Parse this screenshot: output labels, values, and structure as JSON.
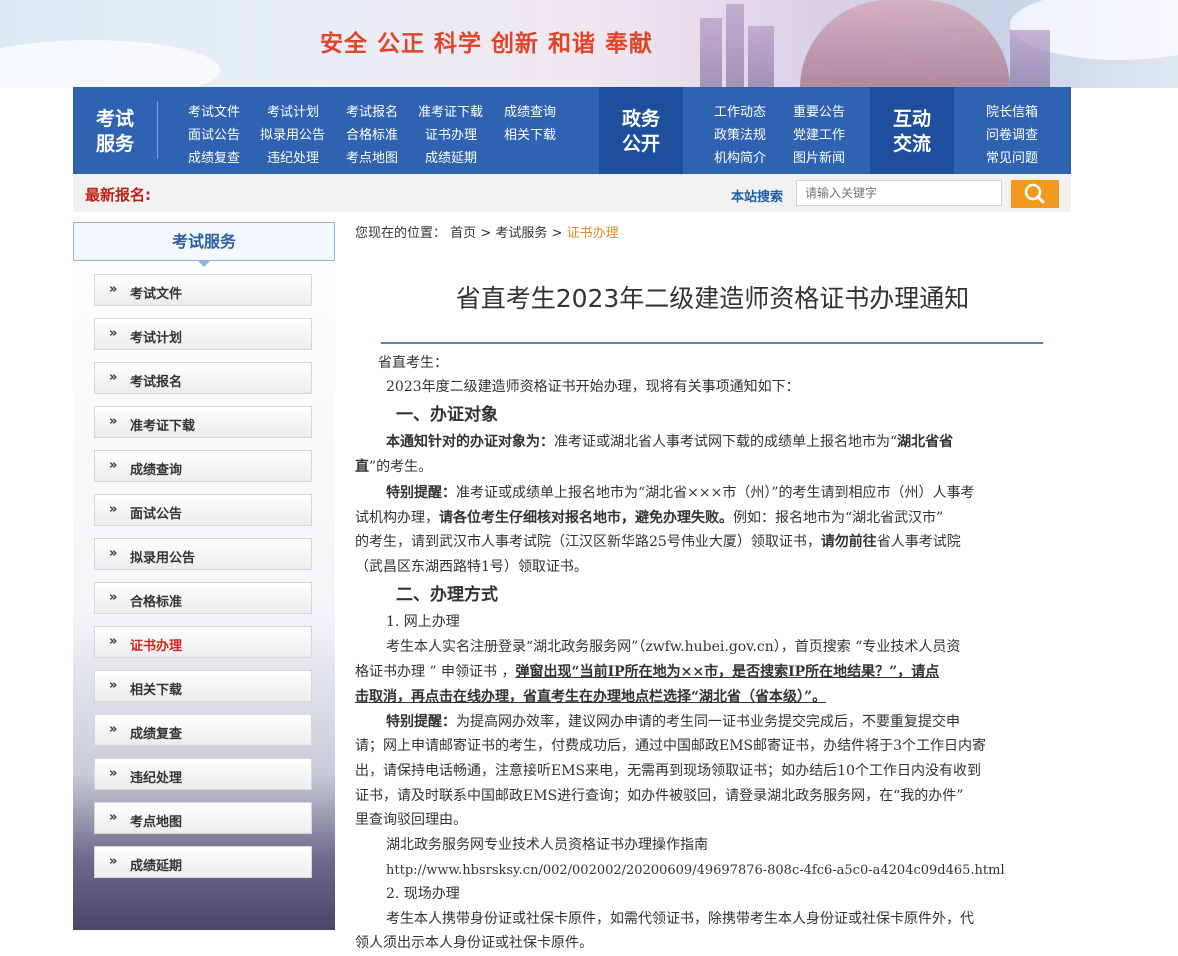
{
  "banner": {
    "slogan": "安全 公正 科学 创新 和谐 奉献"
  },
  "nav": {
    "exam_service_title": [
      "考试",
      "服务"
    ],
    "exam_links": [
      [
        "考试文件",
        "考试计划",
        "考试报名",
        "准考证下载",
        "成绩查询"
      ],
      [
        "面试公告",
        "拟录用公告",
        "合格标准",
        "证书办理",
        "相关下载"
      ],
      [
        "成绩复查",
        "违纪处理",
        "考点地图",
        "成绩延期"
      ]
    ],
    "gov_title": [
      "政务",
      "公开"
    ],
    "gov_links": [
      [
        "工作动态",
        "重要公告"
      ],
      [
        "政策法规",
        "党建工作"
      ],
      [
        "机构简介",
        "图片新闻"
      ]
    ],
    "interact_title": [
      "互动",
      "交流"
    ],
    "interact_links": [
      "院长信箱",
      "问卷调查",
      "常见问题"
    ]
  },
  "search": {
    "latest_label": "最新报名:",
    "site_search": "本站搜索",
    "placeholder": "请输入关键字"
  },
  "sidebar": {
    "title": "考试服务",
    "arrow": "»",
    "items": [
      "考试文件",
      "考试计划",
      "考试报名",
      "准考证下载",
      "成绩查询",
      "面试公告",
      "拟录用公告",
      "合格标准",
      "证书办理",
      "相关下载",
      "成绩复查",
      "违纪处理",
      "考点地图",
      "成绩延期"
    ],
    "active_index": 8
  },
  "breadcrumb": {
    "prefix": "您现在的位置：",
    "home": "首页",
    "sep": ">",
    "section": "考试服务",
    "current": "证书办理"
  },
  "article": {
    "title": "省直考生2023年二级建造师资格证书办理通知",
    "greeting": "省直考生：",
    "intro": "2023年度二级建造师资格证书开始办理，现将有关事项通知如下：",
    "h1": "一、办证对象",
    "p1_bold": "本通知针对的办证对象为：",
    "p1_text": "准考证或湖北省人事考试网下载的成绩单上报名地市为“",
    "p1_bold2a": "湖北省省",
    "p1_bold2b": "直",
    "p1_tail": "”的考生。",
    "p2_label": "特别提醒：",
    "p2_a": "准考证或成绩单上报名地市为“湖北省×××市（州）”的考生请到相应市（州）人事考",
    "p2_b1": "试机构办理，",
    "p2_b2": "请各位考生仔细核对报名地市，避免办理失败。",
    "p2_b3": "例如：报名地市为“湖北省武汉市”",
    "p2_c1": "的考生，请到武汉市人事考试院（江汉区新华路25号伟业大厦）领取证书，",
    "p2_c2": "请勿前往",
    "p2_c3": "省人事考试院",
    "p2_d": "（武昌区东湖西路特1号）领取证书。",
    "h2": "二、办理方式",
    "s1": "1. 网上办理",
    "s1_a": "考生本人实名注册登录“湖北政务服务网”（zwfw.hubei.gov.cn），首页搜索 “专业技术人员资",
    "s1_b1": "格证书办理 ” 申领证书 ，",
    "s1_b2": "弹窗出现“当前IP所在地为××市，是否搜索IP所在地结果？”，请点",
    "s1_c": "击取消，再点击在线办理，省直考生在办理地点栏选择“湖北省（省本级）”。",
    "p3_label": "特别提醒：",
    "p3_a": "为提高网办效率，建议网办申请的考生同一证书业务提交完成后，不要重复提交申",
    "p3_b": "请；网上申请邮寄证书的考生，付费成功后，通过中国邮政EMS邮寄证书，办结件将于3个工作日内寄",
    "p3_c": "出，请保持电话畅通，注意接听EMS来电，无需再到现场领取证书；如办结后10个工作日内没有收到",
    "p3_d": "证书，请及时联系中国邮政EMS进行查询；如办件被驳回，请登录湖北政务服务网，在“我的办件”",
    "p3_e": "里查询驳回理由。",
    "guide": "湖北政务服务网专业技术人员资格证书办理操作指南",
    "url": "http://www.hbsrsksy.cn/002/002002/20200609/49697876-808c-4fc6-a5c0-a4204c09d465.html",
    "s2": "2. 现场办理",
    "s2_a": "考生本人携带身份证或社保卡原件，如需代领证书，除携带考生本人身份证或社保卡原件外，代",
    "s2_b": "领人须出示本人身份证或社保卡原件。"
  },
  "colors": {
    "nav_blue": "#2f62b0",
    "accent_orange": "#f29a1b",
    "active_red": "#d4261c",
    "slogan_red": "#e0442a"
  }
}
